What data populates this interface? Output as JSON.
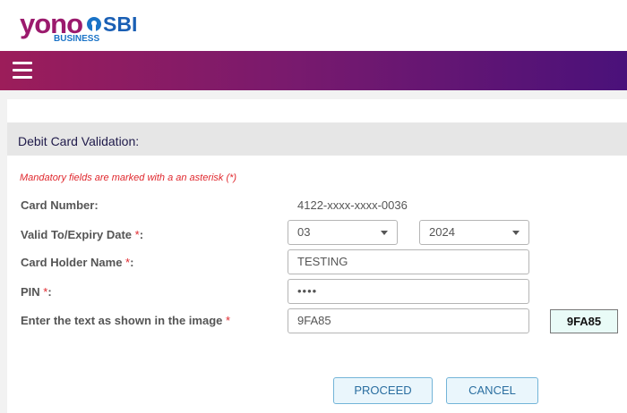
{
  "header": {
    "logo_yono": "yono",
    "logo_sbi": "SBI",
    "logo_business": "BUSINESS"
  },
  "nav": {
    "menu_icon": "hamburger-menu-icon"
  },
  "form": {
    "section_title": "Debit Card Validation:",
    "mandatory_note": "Mandatory fields are marked with a an asterisk (*)",
    "card_number_label": "Card Number:",
    "card_number_value": "4122-xxxx-xxxx-0036",
    "expiry_label": "Valid To/Expiry Date",
    "expiry_month": "03",
    "expiry_year": "2024",
    "holder_label": "Card Holder Name",
    "holder_value": "TESTING",
    "pin_label": "PIN",
    "pin_value": "••••",
    "captcha_label": "Enter the text as shown in the image",
    "captcha_input_value": "9FA85",
    "captcha_image_text": "9FA85",
    "asterisk": "*",
    "colon": ":"
  },
  "buttons": {
    "proceed": "PROCEED",
    "cancel": "CANCEL"
  },
  "colors": {
    "brand_magenta": "#9c1d5a",
    "brand_purple": "#4a117a",
    "required_red": "#e0282e",
    "button_blue": "#2a6ea0"
  }
}
